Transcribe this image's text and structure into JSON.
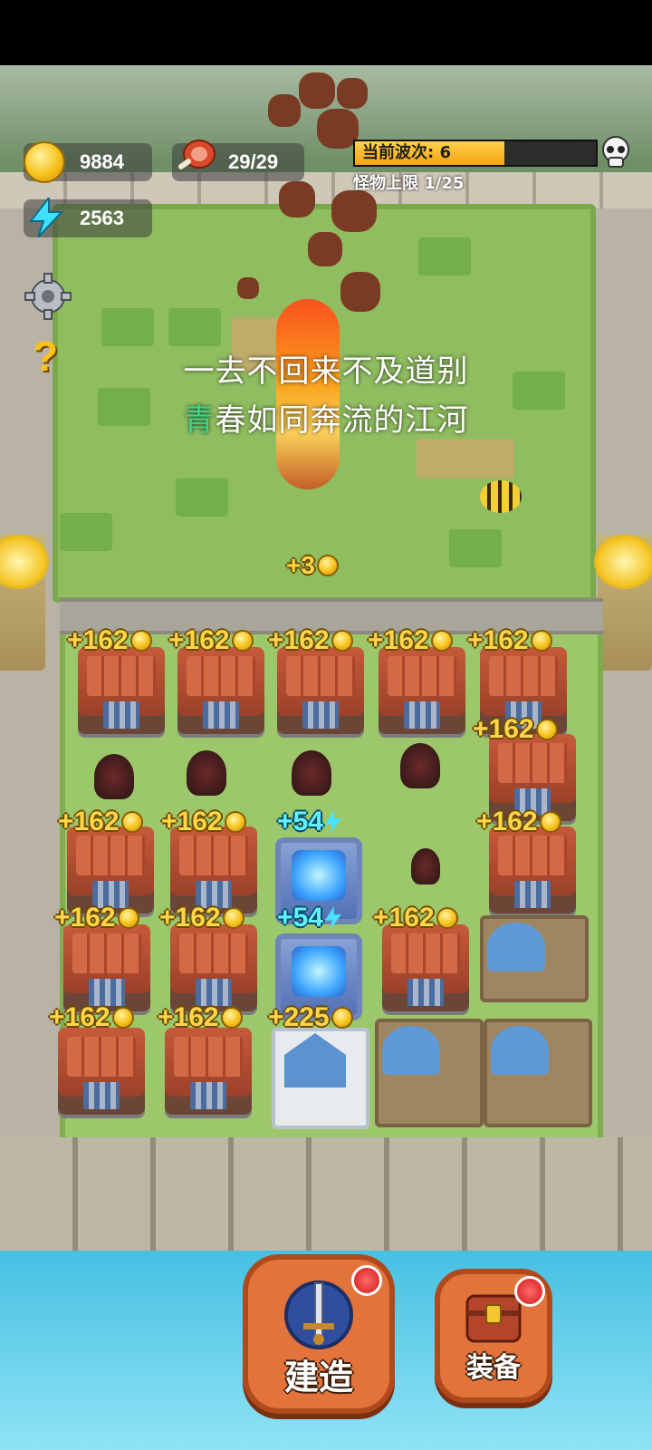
{
  "hud": {
    "gold": "9884",
    "food": "29/29",
    "energy": "2563",
    "wave_label": "当前波次: 6",
    "wave_progress": 0.62,
    "monster_limit": "怪物上限 1/25"
  },
  "lyrics": {
    "line1": "一去不回来不及道别",
    "line2_highlight": "青",
    "line2_rest": "春如同奔流的江河"
  },
  "field": {
    "drop_label": "+3"
  },
  "gains": {
    "gold": "+162",
    "energy": "+54",
    "castle": "+225"
  },
  "buttons": {
    "build": "建造",
    "equip": "装备"
  },
  "icons": {
    "gold": "coin-icon",
    "food": "meat-icon",
    "energy": "lightning-icon",
    "wave": "skull-icon",
    "settings": "gear-icon",
    "help": "question-icon"
  },
  "colors": {
    "gold_text": "#ffd54a",
    "energy_text": "#63f0ff",
    "wave_bar": "#f5a314",
    "lyric_highlight": "#33d98a"
  }
}
